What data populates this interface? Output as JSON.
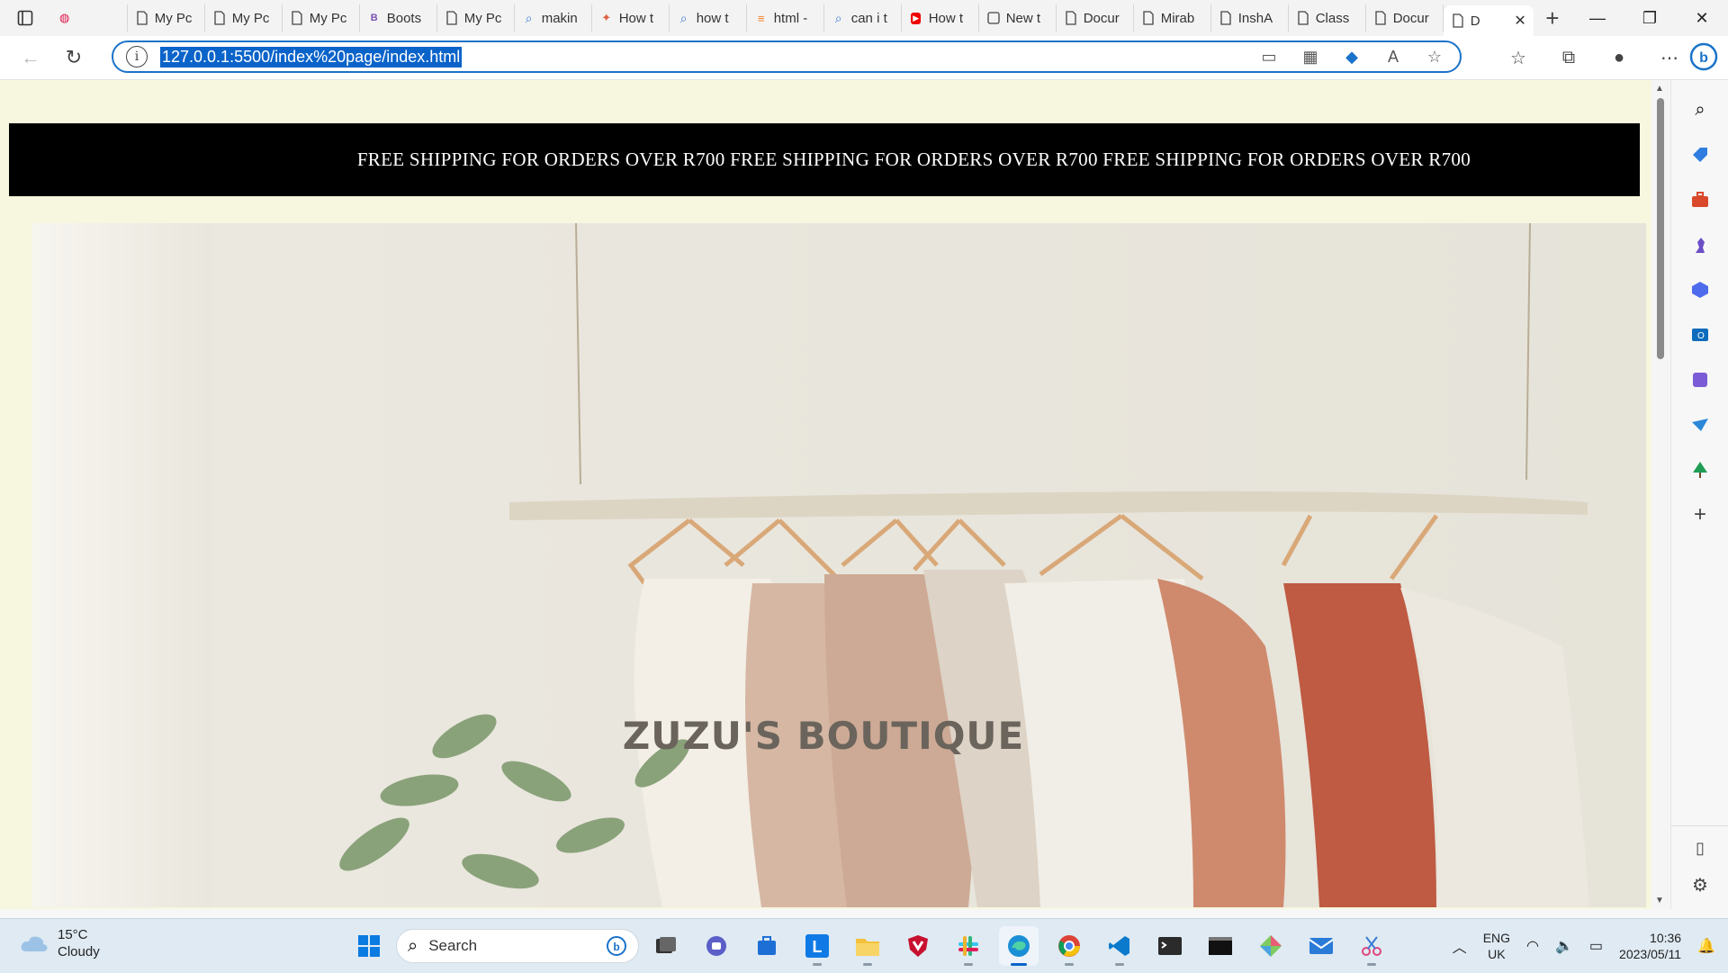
{
  "browser": {
    "tabs": [
      {
        "label": "",
        "icon": "app-icon"
      },
      {
        "label": "My Pc",
        "icon": "page-icon"
      },
      {
        "label": "My Pc",
        "icon": "page-icon"
      },
      {
        "label": "My Pc",
        "icon": "page-icon"
      },
      {
        "label": "Boots",
        "icon": "bootstrap-icon"
      },
      {
        "label": "My Pc",
        "icon": "page-icon"
      },
      {
        "label": "makin",
        "icon": "search-icon"
      },
      {
        "label": "How t",
        "icon": "site-icon"
      },
      {
        "label": "how t",
        "icon": "search-icon"
      },
      {
        "label": "html -",
        "icon": "stack-icon"
      },
      {
        "label": "can i t",
        "icon": "search-icon"
      },
      {
        "label": "How t",
        "icon": "youtube-icon"
      },
      {
        "label": "New t",
        "icon": "newtab-icon"
      },
      {
        "label": "Docur",
        "icon": "page-icon"
      },
      {
        "label": "Mirab",
        "icon": "page-icon"
      },
      {
        "label": "InshA",
        "icon": "page-icon"
      },
      {
        "label": "Class",
        "icon": "page-icon"
      },
      {
        "label": "Docur",
        "icon": "page-icon"
      }
    ],
    "active_tab": {
      "label": "D",
      "close": "✕"
    },
    "new_tab": "+",
    "address": {
      "url": "127.0.0.1:5500/index%20page/index.html"
    }
  },
  "page": {
    "banner_text": "FREE SHIPPING FOR ORDERS OVER R700 FREE SHIPPING FOR ORDERS OVER R700 FREE SHIPPING FOR ORDERS OVER R700",
    "hero_title": "ZUZU'S BOUTIQUE"
  },
  "taskbar": {
    "weather": {
      "temp": "15°C",
      "condition": "Cloudy"
    },
    "search_placeholder": "Search",
    "tray": {
      "lang": "ENG",
      "region": "UK",
      "time": "10:36",
      "date": "2023/05/11"
    }
  },
  "colors": {
    "page_bg": "#f7f6df",
    "banner_bg": "#000000",
    "hero_title": "#6a645c",
    "url_highlight": "#0a63c9"
  }
}
